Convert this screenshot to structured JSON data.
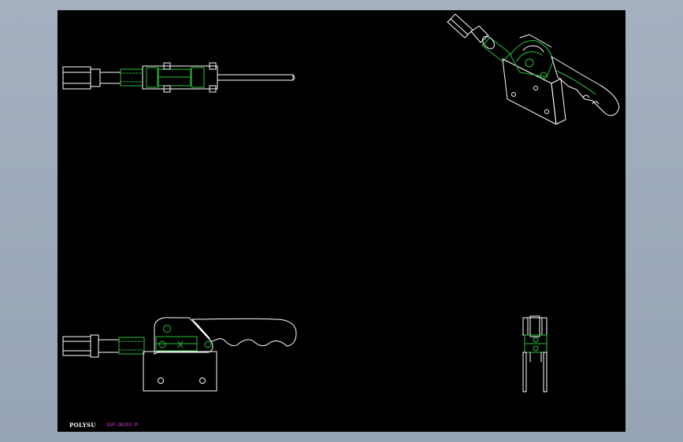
{
  "colors": {
    "background": "#9aa7b8",
    "sheet": "#000000",
    "line_white": "#ffffff",
    "line_green": "#27c23a",
    "titleblock_text": "#e23ad6"
  },
  "titleblock": {
    "logo_text": "POLYSU",
    "part_number": "SSP-30292 M"
  }
}
